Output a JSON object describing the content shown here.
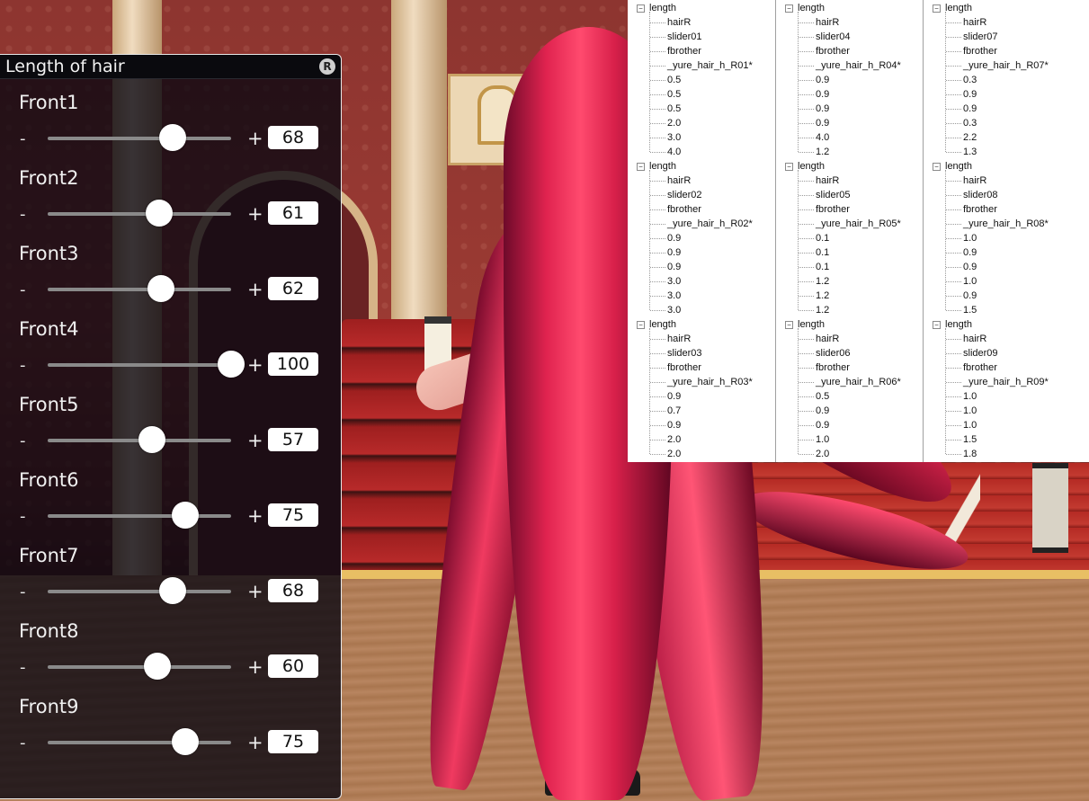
{
  "panel": {
    "title": "Length of hair",
    "reset_label": "R",
    "minus_label": "-",
    "plus_label": "+",
    "sliders": [
      {
        "label": "Front1",
        "value": "68",
        "level": 68
      },
      {
        "label": "Front2",
        "value": "61",
        "level": 61
      },
      {
        "label": "Front3",
        "value": "62",
        "level": 62
      },
      {
        "label": "Front4",
        "value": "100",
        "level": 100
      },
      {
        "label": "Front5",
        "value": "57",
        "level": 57
      },
      {
        "label": "Front6",
        "value": "75",
        "level": 75
      },
      {
        "label": "Front7",
        "value": "68",
        "level": 68
      },
      {
        "label": "Front8",
        "value": "60",
        "level": 60
      },
      {
        "label": "Front9",
        "value": "75",
        "level": 75
      }
    ]
  },
  "tree": {
    "columns": [
      [
        {
          "root": "length",
          "children": [
            "hairR",
            "slider01",
            "fbrother",
            "_yure_hair_h_R01*",
            "0.5",
            "0.5",
            "0.5",
            "2.0",
            "3.0",
            "4.0"
          ]
        },
        {
          "root": "length",
          "children": [
            "hairR",
            "slider02",
            "fbrother",
            "_yure_hair_h_R02*",
            "0.9",
            "0.9",
            "0.9",
            "3.0",
            "3.0",
            "3.0"
          ]
        },
        {
          "root": "length",
          "children": [
            "hairR",
            "slider03",
            "fbrother",
            "_yure_hair_h_R03*",
            "0.9",
            "0.7",
            "0.9",
            "2.0",
            "2.0"
          ]
        }
      ],
      [
        {
          "root": "length",
          "children": [
            "hairR",
            "slider04",
            "fbrother",
            "_yure_hair_h_R04*",
            "0.9",
            "0.9",
            "0.9",
            "0.9",
            "4.0",
            "1.2"
          ]
        },
        {
          "root": "length",
          "children": [
            "hairR",
            "slider05",
            "fbrother",
            "_yure_hair_h_R05*",
            "0.1",
            "0.1",
            "0.1",
            "1.2",
            "1.2",
            "1.2"
          ]
        },
        {
          "root": "length",
          "children": [
            "hairR",
            "slider06",
            "fbrother",
            "_yure_hair_h_R06*",
            "0.5",
            "0.9",
            "0.9",
            "1.0",
            "2.0"
          ]
        }
      ],
      [
        {
          "root": "length",
          "children": [
            "hairR",
            "slider07",
            "fbrother",
            "_yure_hair_h_R07*",
            "0.3",
            "0.9",
            "0.9",
            "0.3",
            "2.2",
            "1.3"
          ]
        },
        {
          "root": "length",
          "children": [
            "hairR",
            "slider08",
            "fbrother",
            "_yure_hair_h_R08*",
            "1.0",
            "0.9",
            "0.9",
            "1.0",
            "0.9",
            "1.5"
          ]
        },
        {
          "root": "length",
          "children": [
            "hairR",
            "slider09",
            "fbrother",
            "_yure_hair_h_R09*",
            "1.0",
            "1.0",
            "1.0",
            "1.5",
            "1.8"
          ]
        }
      ]
    ]
  }
}
